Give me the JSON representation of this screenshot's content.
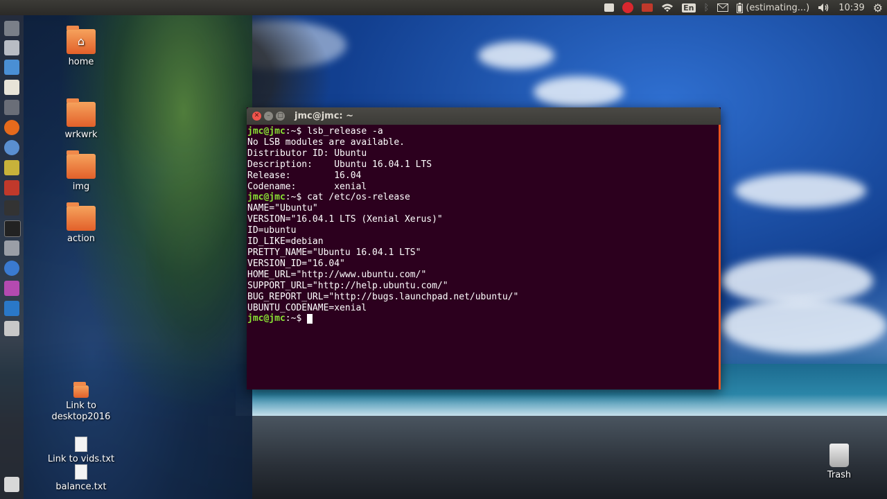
{
  "top_panel": {
    "battery_text": "(estimating...)",
    "keyboard_layout": "En",
    "clock": "10:39",
    "indicators": [
      "edit-icon",
      "mega-icon",
      "record-icon",
      "wifi-icon",
      "keyboard-icon",
      "bluetooth-icon",
      "mail-icon",
      "battery-icon",
      "volume-icon",
      "gear-icon"
    ]
  },
  "desktop_icons": [
    {
      "label": "home",
      "type": "folder",
      "glyph": "⌂"
    },
    {
      "label": "wrkwrk",
      "type": "folder",
      "glyph": ""
    },
    {
      "label": "img",
      "type": "folder",
      "glyph": ""
    },
    {
      "label": "action",
      "type": "folder",
      "glyph": ""
    },
    {
      "label": "Link to desktop2016",
      "type": "folder-link",
      "glyph": ""
    },
    {
      "label": "Link to vids.txt",
      "type": "file"
    },
    {
      "label": "balance.txt",
      "type": "file"
    }
  ],
  "trash": {
    "label": "Trash"
  },
  "terminal": {
    "title": "jmc@jmc: ~",
    "prompt": "jmc@jmc",
    "prompt_suffix": ":~$",
    "lines": [
      {
        "prompt": true,
        "text": " lsb_release -a"
      },
      {
        "prompt": false,
        "text": "No LSB modules are available."
      },
      {
        "prompt": false,
        "text": "Distributor ID: Ubuntu"
      },
      {
        "prompt": false,
        "text": "Description:    Ubuntu 16.04.1 LTS"
      },
      {
        "prompt": false,
        "text": "Release:        16.04"
      },
      {
        "prompt": false,
        "text": "Codename:       xenial"
      },
      {
        "prompt": true,
        "text": " cat /etc/os-release"
      },
      {
        "prompt": false,
        "text": "NAME=\"Ubuntu\""
      },
      {
        "prompt": false,
        "text": "VERSION=\"16.04.1 LTS (Xenial Xerus)\""
      },
      {
        "prompt": false,
        "text": "ID=ubuntu"
      },
      {
        "prompt": false,
        "text": "ID_LIKE=debian"
      },
      {
        "prompt": false,
        "text": "PRETTY_NAME=\"Ubuntu 16.04.1 LTS\""
      },
      {
        "prompt": false,
        "text": "VERSION_ID=\"16.04\""
      },
      {
        "prompt": false,
        "text": "HOME_URL=\"http://www.ubuntu.com/\""
      },
      {
        "prompt": false,
        "text": "SUPPORT_URL=\"http://help.ubuntu.com/\""
      },
      {
        "prompt": false,
        "text": "BUG_REPORT_URL=\"http://bugs.launchpad.net/ubuntu/\""
      },
      {
        "prompt": false,
        "text": "UBUNTU_CODENAME=xenial"
      },
      {
        "prompt": true,
        "text": " "
      }
    ]
  },
  "colors": {
    "terminal_bg": "#2c001e",
    "prompt_green": "#8ae234",
    "ubuntu_orange": "#e95420",
    "panel_bg": "#3c3b37"
  }
}
